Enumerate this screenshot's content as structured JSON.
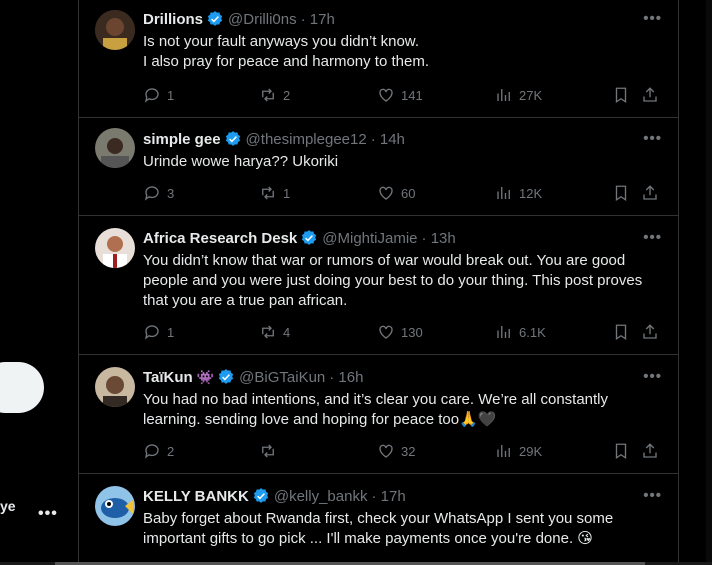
{
  "sidebar": {
    "partial_text": "ye",
    "more_label": "•••"
  },
  "replies": [
    {
      "name": "Drillions",
      "handle": "@Drilli0ns",
      "time": "· 17h",
      "text": "Is not your fault anyways you didn’t know.\nI also pray for peace and harmony to them.",
      "replies": "1",
      "reposts": "2",
      "likes": "141",
      "views": "27K",
      "avatar_color": "#5a3a2a"
    },
    {
      "name": "simple gee",
      "handle": "@thesimplegee12",
      "time": "· 14h",
      "text": "Urinde wowe harya?? Ukoriki",
      "replies": "3",
      "reposts": "1",
      "likes": "60",
      "views": "12K",
      "avatar_color": "#6b6b5a"
    },
    {
      "name": "Africa Research Desk",
      "handle": "@MightiJamie",
      "time": "· 13h",
      "text": "You didn’t know that war or rumors of war would break out. You are good people and you were just doing your best to do your thing. This post proves that you are a true pan african.",
      "replies": "1",
      "reposts": "4",
      "likes": "130",
      "views": "6.1K",
      "avatar_color": "#c9b7a8"
    },
    {
      "name": "TaïKun",
      "name_emoji": "👾",
      "handle": "@BiGTaiKun",
      "time": "· 16h",
      "text": "You had no bad intentions, and it’s clear you care. We’re all constantly learning. sending love and hoping for peace too🙏🖤",
      "replies": "2",
      "reposts": "",
      "likes": "32",
      "views": "29K",
      "avatar_color": "#8a7a6a"
    },
    {
      "name": "KELLY BANKK",
      "handle": "@kelly_bankk",
      "time": "· 17h",
      "text": "Baby forget about Rwanda first, check your WhatsApp I sent you some important gifts to go pick ... I'll make payments once you're done. 😘",
      "avatar_color": "#2a6fb0"
    }
  ],
  "more_label": "•••",
  "colors": {
    "background": "#000000",
    "border": "#2f3336",
    "text": "#e7e9ea",
    "secondary": "#71767b",
    "verified": "#1d9bf0"
  }
}
